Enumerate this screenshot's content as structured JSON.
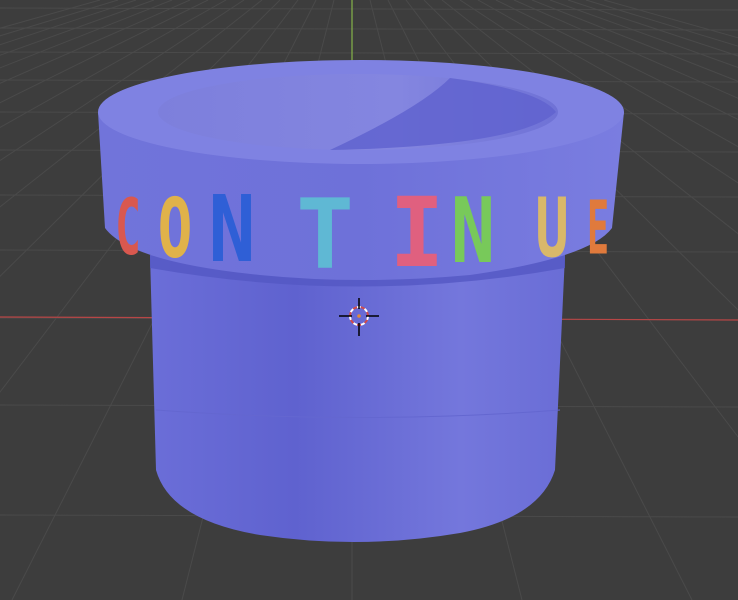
{
  "viewport": {
    "background": "#3d3d3d",
    "grid_color": "#4a4a4a",
    "x_axis_color": "#c24a4a",
    "y_axis_color": "#86b34a"
  },
  "object": {
    "name": "pipe",
    "body_color": "#6f72d8",
    "body_shadow": "#5a5dc8",
    "rim_color": "#7478de",
    "inner_color": "#7f80de"
  },
  "rim_text": {
    "letters": [
      {
        "char": "C",
        "color": "#d9584f"
      },
      {
        "char": "O",
        "color": "#e0b24a"
      },
      {
        "char": "N",
        "color": "#2f5fd6"
      },
      {
        "char": "T",
        "color": "#5fb8d4"
      },
      {
        "char": "I",
        "color": "#e0607f"
      },
      {
        "char": "N",
        "color": "#78c95a"
      },
      {
        "char": "U",
        "color": "#d9b86a"
      },
      {
        "char": "E",
        "color": "#e07a3c"
      }
    ]
  },
  "cursor": {
    "name": "3d-cursor",
    "ring_color_a": "#ffffff",
    "ring_color_b": "#d24a4a",
    "cross_color": "#000000"
  }
}
